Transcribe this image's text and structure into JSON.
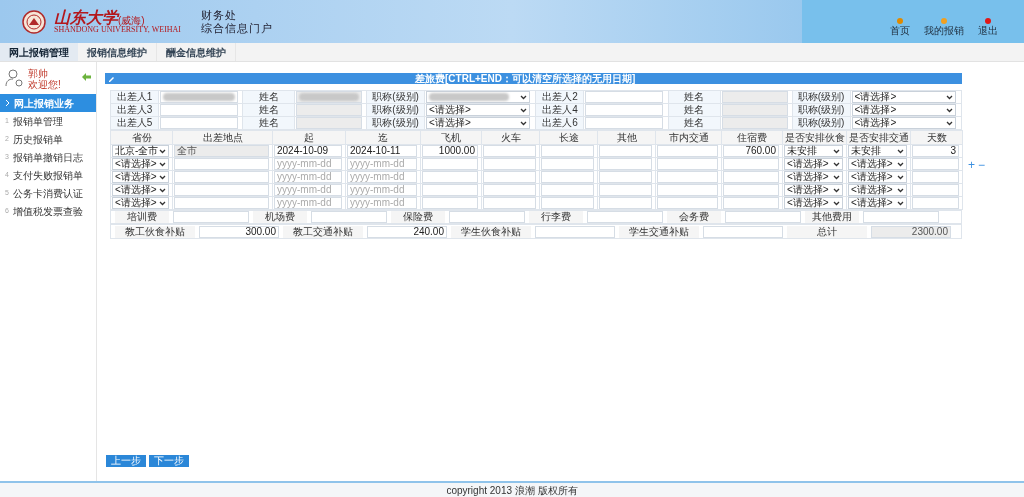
{
  "header": {
    "brand": "山东大学",
    "brand_suffix": "(威海)",
    "brand_en": "SHANDONG UNIVERSITY, WEIHAI",
    "dept": "财务处",
    "portal": "综合信息门户",
    "links": [
      {
        "label": "首页",
        "color": "#e08a00"
      },
      {
        "label": "我的报销",
        "color": "#f0a020"
      },
      {
        "label": "退出",
        "color": "#e01818"
      }
    ]
  },
  "tabs": [
    {
      "label": "网上报销管理",
      "selected": true
    },
    {
      "label": "报销信息维护",
      "selected": false
    },
    {
      "label": "酬金信息维护",
      "selected": false
    }
  ],
  "user": {
    "name": "郭帅",
    "greeting": "欢迎您!"
  },
  "sidebar": [
    {
      "label": "网上报销业务",
      "selected": true
    },
    {
      "number": "1",
      "label": "报销单管理",
      "selected": false
    },
    {
      "number": "2",
      "label": "历史报销单",
      "selected": false
    },
    {
      "number": "3",
      "label": "报销单撤销日志",
      "selected": false
    },
    {
      "number": "4",
      "label": "支付失败报销单",
      "selected": false
    },
    {
      "number": "5",
      "label": "公务卡消费认证",
      "selected": false
    },
    {
      "number": "6",
      "label": "增值税发票查验",
      "selected": false
    }
  ],
  "panel_title": "差旅费[CTRL+END：可以清空所选择的无用日期]",
  "travelers": [
    {
      "label": "出差人1",
      "id_redacted": true,
      "name_label": "姓名",
      "name_redacted": true,
      "title_label": "职称(级别)",
      "title_redacted": true
    },
    {
      "label": "出差人2",
      "name_label": "姓名",
      "title_label": "职称(级别)",
      "title": "<请选择>"
    },
    {
      "label": "出差人3",
      "name_label": "姓名",
      "title_label": "职称(级别)",
      "title": "<请选择>"
    },
    {
      "label": "出差人4",
      "name_label": "姓名",
      "title_label": "职称(级别)",
      "title": "<请选择>"
    },
    {
      "label": "出差人5",
      "name_label": "姓名",
      "title_label": "职称(级别)",
      "title": "<请选择>"
    },
    {
      "label": "出差人6",
      "name_label": "姓名",
      "title_label": "职称(级别)",
      "title": "<请选择>"
    }
  ],
  "row_controls": [
    "+",
    "−"
  ],
  "expense_table": {
    "columns": [
      "省份",
      "出差地点",
      "起",
      "迄",
      "飞机",
      "火车",
      "长途",
      "其他",
      "市内交通",
      "住宿费",
      "是否安排伙食",
      "是否安排交通",
      "天数"
    ],
    "rows": [
      [
        {
          "kind": "select",
          "value": "北京-全市"
        },
        {
          "kind": "input",
          "value": "全市",
          "disabled": true
        },
        {
          "kind": "input",
          "value": "2024-10-09"
        },
        {
          "kind": "input",
          "value": "2024-10-11"
        },
        {
          "kind": "input",
          "value": "1000.00"
        },
        {
          "kind": "input"
        },
        {
          "kind": "input"
        },
        {
          "kind": "input"
        },
        {
          "kind": "input"
        },
        {
          "kind": "input",
          "value": "760.00"
        },
        {
          "kind": "select",
          "value": "未安排"
        },
        {
          "kind": "select",
          "value": "未安排"
        },
        {
          "kind": "input",
          "value": "3"
        }
      ],
      [
        {
          "kind": "select",
          "value": "<请选择>"
        },
        {
          "kind": "input"
        },
        {
          "kind": "input",
          "placeholder": "yyyy-mm-dd"
        },
        {
          "kind": "input",
          "placeholder": "yyyy-mm-dd"
        },
        {
          "kind": "input"
        },
        {
          "kind": "input"
        },
        {
          "kind": "input"
        },
        {
          "kind": "input"
        },
        {
          "kind": "input"
        },
        {
          "kind": "input"
        },
        {
          "kind": "select",
          "value": "<请选择>"
        },
        {
          "kind": "select",
          "value": "<请选择>"
        },
        {
          "kind": "input"
        }
      ],
      [
        {
          "kind": "select",
          "value": "<请选择>"
        },
        {
          "kind": "input"
        },
        {
          "kind": "input",
          "placeholder": "yyyy-mm-dd"
        },
        {
          "kind": "input",
          "placeholder": "yyyy-mm-dd"
        },
        {
          "kind": "input"
        },
        {
          "kind": "input"
        },
        {
          "kind": "input"
        },
        {
          "kind": "input"
        },
        {
          "kind": "input"
        },
        {
          "kind": "input"
        },
        {
          "kind": "select",
          "value": "<请选择>"
        },
        {
          "kind": "select",
          "value": "<请选择>"
        },
        {
          "kind": "input"
        }
      ],
      [
        {
          "kind": "select",
          "value": "<请选择>"
        },
        {
          "kind": "input"
        },
        {
          "kind": "input",
          "placeholder": "yyyy-mm-dd"
        },
        {
          "kind": "input",
          "placeholder": "yyyy-mm-dd"
        },
        {
          "kind": "input"
        },
        {
          "kind": "input"
        },
        {
          "kind": "input"
        },
        {
          "kind": "input"
        },
        {
          "kind": "input"
        },
        {
          "kind": "input"
        },
        {
          "kind": "select",
          "value": "<请选择>"
        },
        {
          "kind": "select",
          "value": "<请选择>"
        },
        {
          "kind": "input"
        }
      ],
      [
        {
          "kind": "select",
          "value": "<请选择>"
        },
        {
          "kind": "input"
        },
        {
          "kind": "input",
          "placeholder": "yyyy-mm-dd"
        },
        {
          "kind": "input",
          "placeholder": "yyyy-mm-dd"
        },
        {
          "kind": "input"
        },
        {
          "kind": "input"
        },
        {
          "kind": "input"
        },
        {
          "kind": "input"
        },
        {
          "kind": "input"
        },
        {
          "kind": "input"
        },
        {
          "kind": "select",
          "value": "<请选择>"
        },
        {
          "kind": "select",
          "value": "<请选择>"
        },
        {
          "kind": "input"
        }
      ]
    ]
  },
  "fees": [
    {
      "label": "培训费"
    },
    {
      "label": "机场费"
    },
    {
      "label": "保险费"
    },
    {
      "label": "行李费"
    },
    {
      "label": "会务费"
    },
    {
      "label": "其他费用"
    }
  ],
  "subsidies": [
    {
      "label": "教工伙食补贴",
      "value": "300.00"
    },
    {
      "label": "教工交通补贴",
      "value": "240.00"
    },
    {
      "label": "学生伙食补贴"
    },
    {
      "label": "学生交通补贴"
    },
    {
      "label": "总计",
      "value": "2300.00",
      "disabled": true
    }
  ],
  "buttons": [
    "上一步",
    "下一步"
  ],
  "footer": "copyright 2013 浪潮 版权所有"
}
